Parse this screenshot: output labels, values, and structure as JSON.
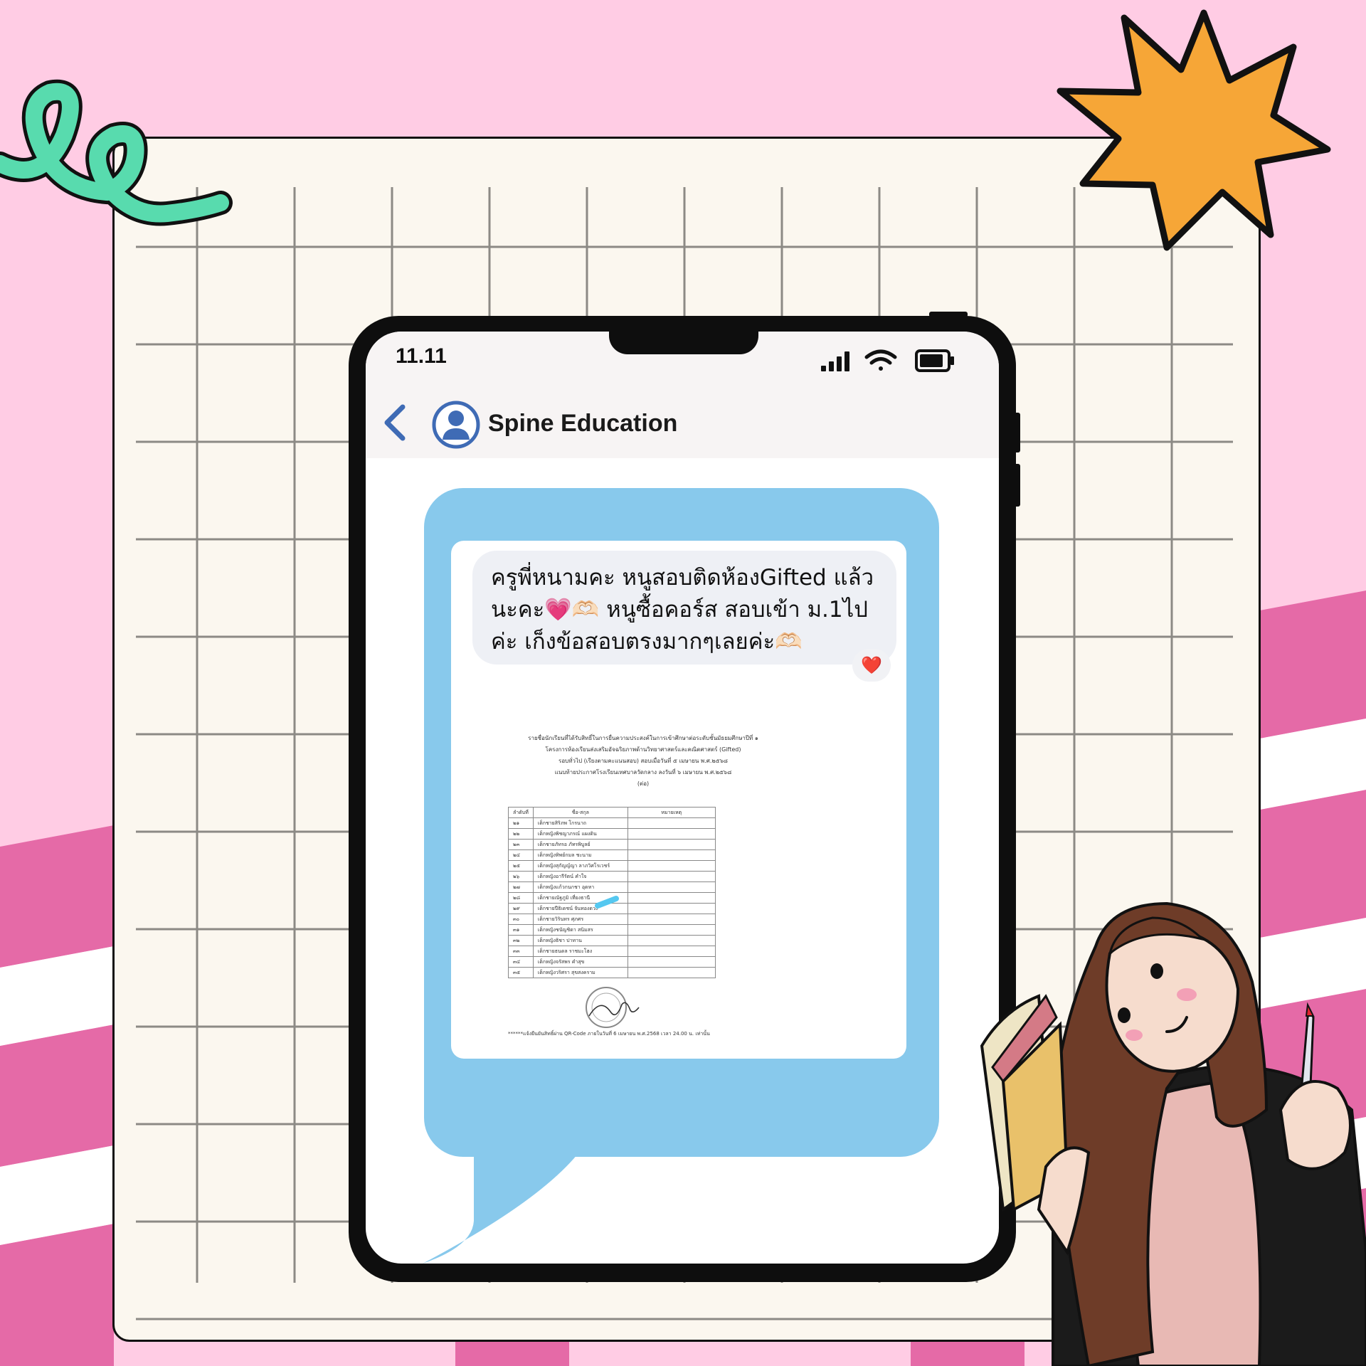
{
  "status_bar": {
    "time": "11.11"
  },
  "chat_header": {
    "contact_name": "Spine Education"
  },
  "message": {
    "text": "ครูพี่หนามคะ หนูสอบติดห้องGifted แล้วนะคะ💗🫶🏻 หนูซื้อคอร์ส สอบเข้า ม.1ไปค่ะ เก็งข้อสอบตรงมากๆเลยค่ะ🫶🏻",
    "reaction": "❤️"
  },
  "document": {
    "title_lines": [
      "รายชื่อนักเรียนที่ได้รับสิทธิ์ในการยื่นความประสงค์ในการเข้าศึกษาต่อระดับชั้นมัธยมศึกษาปีที่ ๑",
      "โครงการห้องเรียนส่งเสริมอัจฉริยภาพด้านวิทยาศาสตร์และคณิตศาสตร์ (Gifted)",
      "รอบทั่วไป (เรียงตามคะแนนสอบ) สอบเมื่อวันที่ ๕ เมษายน พ.ศ.๒๕๖๘",
      "แนบท้ายประกาศโรงเรียนเทศบาลวัดกลาง ลงวันที่ ๖ เมษายน พ.ศ.๒๕๖๘",
      "(ต่อ)"
    ],
    "table_headers": [
      "ลำดับที่",
      "ชื่อ-สกุล",
      "หมายเหตุ"
    ],
    "rows": [
      [
        "๒๑",
        "เด็กชายสิริภพ โกรนาถ",
        ""
      ],
      [
        "๒๒",
        "เด็กหญิงพิชญาภรณ์ แผงดิน",
        ""
      ],
      [
        "๒๓",
        "เด็กชายภัทรอ ภัทรพิบูลย์",
        ""
      ],
      [
        "๒๔",
        "เด็กหญิงทิพย์กมล ชะนาม",
        ""
      ],
      [
        "๒๕",
        "เด็กหญิงสุกัญญ์ญา ลาภวิศโรเวชร์",
        ""
      ],
      [
        "๒๖",
        "เด็กหญิงอารีรัตน์ คำใจ",
        ""
      ],
      [
        "๒๗",
        "เด็กหญิงแก้วกนกชา อุดหา",
        ""
      ],
      [
        "๒๘",
        "เด็กชายณัฐภูมิ เที่ยงธานี",
        ""
      ],
      [
        "๒๙",
        "เด็กชายปีธิเดชน์ จันทองดวง",
        ""
      ],
      [
        "๓๐",
        "เด็กชายวิรินทร ศุภศร",
        ""
      ],
      [
        "๓๑",
        "เด็กหญิงชนัญชิดา สนิมสร",
        ""
      ],
      [
        "๓๒",
        "เด็กหญิงธิชา ปาทาน",
        ""
      ],
      [
        "๓๓",
        "เด็กชายธนดล ราชมะโฮง",
        ""
      ],
      [
        "๓๔",
        "เด็กหญิงจรัสพร คำสุข",
        ""
      ],
      [
        "๓๕",
        "เด็กหญิงวริศรา สุขสงคราม",
        ""
      ]
    ],
    "footer_note": "******แจ้งยืนยันสิทธิ์ผ่าน QR-Code ภายในวันที่ 6 เมษายน พ.ศ.2568 เวลา 24.00 น. เท่านั้น"
  },
  "colors": {
    "background_pink": "#FFCCE4",
    "checker_magenta": "#E56AA7",
    "board": "#FBF7EF",
    "bubble_blue": "#88C9EC",
    "accent_blue": "#3F6BB5",
    "star_orange": "#F6A637",
    "squiggle_green": "#58DBAE"
  },
  "icons": [
    "signal-icon",
    "wifi-icon",
    "battery-icon",
    "back-chevron-icon",
    "avatar-icon",
    "heart-reaction-icon",
    "star-decoration",
    "squiggle-decoration",
    "girl-illustration"
  ]
}
